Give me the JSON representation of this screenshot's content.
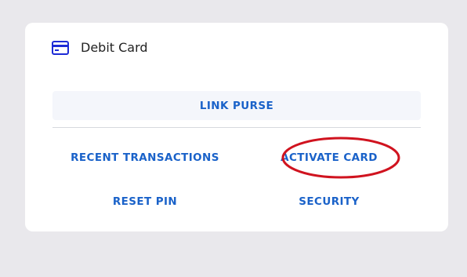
{
  "card": {
    "title": "Debit Card",
    "icon": "credit-card-icon"
  },
  "actions": {
    "link_purse": "LINK PURSE",
    "recent_transactions": "RECENT TRANSACTIONS",
    "activate_card": "ACTIVATE CARD",
    "reset_pin": "RESET PIN",
    "security": "SECURITY"
  },
  "colors": {
    "accent": "#1a62c9",
    "highlight": "#d0131f",
    "background": "#e9e8ec"
  }
}
